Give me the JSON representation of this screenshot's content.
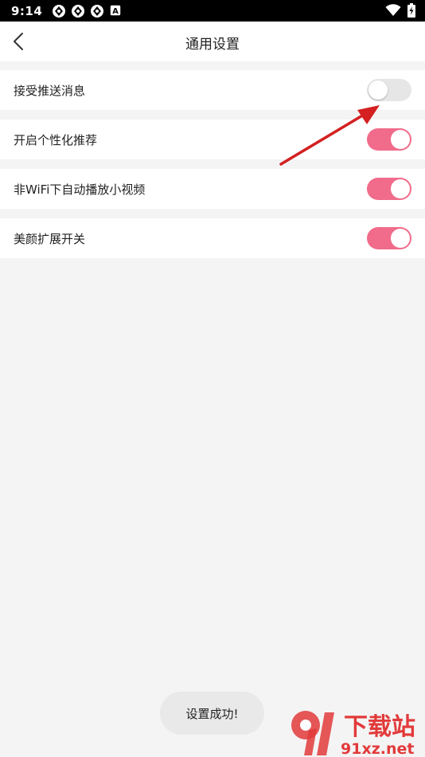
{
  "status_bar": {
    "time": "9:14",
    "notification_icons": [
      "aperture-icon",
      "aperture-icon",
      "aperture-icon",
      "app-badge-icon"
    ],
    "app_badge_letter": "A",
    "right_icons": [
      "wifi-icon",
      "battery-charging-icon"
    ]
  },
  "header": {
    "title": "通用设置",
    "back_icon": "chevron-left-icon"
  },
  "settings": [
    {
      "label": "接受推送消息",
      "enabled": false
    },
    {
      "label": "开启个性化推荐",
      "enabled": true
    },
    {
      "label": "非WiFi下自动播放小视频",
      "enabled": true
    },
    {
      "label": "美颜扩展开关",
      "enabled": true
    }
  ],
  "colors": {
    "toggle_on": "#f16b8a",
    "toggle_off": "#e6e6e6",
    "page_background": "#f4f4f4",
    "annotation_arrow": "#d42020"
  },
  "toast": {
    "text": "设置成功!"
  },
  "watermark": {
    "logo_icon": "91-logo-icon",
    "text_top": "下载站",
    "text_bottom": "91xz.net"
  }
}
